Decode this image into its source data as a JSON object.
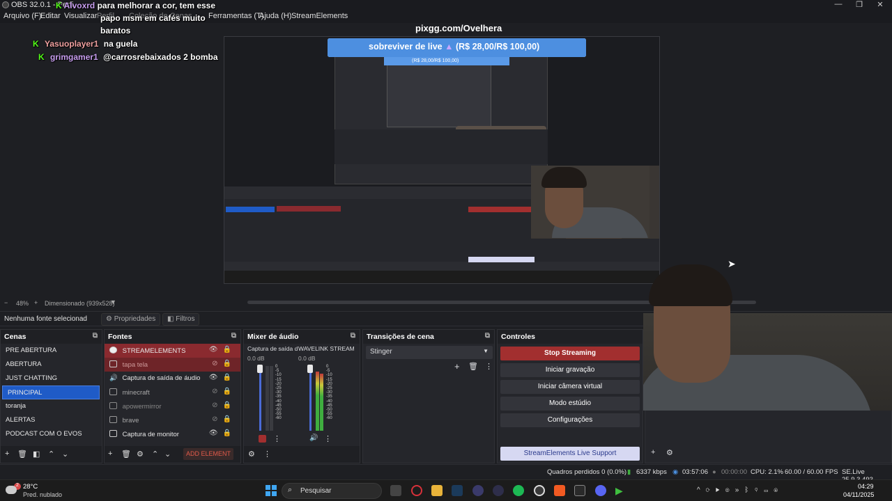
{
  "window": {
    "title": "OBS 32.0.1 - Perfi",
    "minimize": "—",
    "maximize": "❐",
    "close": "✕"
  },
  "menu": {
    "items": [
      "Arquivo (F)",
      "Editar",
      "Visualizar",
      "Perfil",
      "Coleção de Cenas",
      "Ferramentas (T)",
      "Ajuda (H)",
      "StreamElements"
    ]
  },
  "chat": {
    "messages": [
      {
        "user": "Alvoxrd",
        "text": "para melhorar a cor, tem esse"
      },
      {
        "user": "",
        "text": "papo msm em cafés muito"
      },
      {
        "user": "",
        "text": "baratos"
      },
      {
        "user": "Yasuoplayer1",
        "text": "na guela"
      },
      {
        "user": "grimgamer1",
        "text": "@carrosrebaixados 2 bomba"
      }
    ]
  },
  "overlay": {
    "url": "pixgg.com/Ovelhera",
    "goal_text": "sobreviver de live",
    "goal_amount": "(R$ 28,00/R$ 100,00)",
    "inner_goal": "(R$ 28,00/R$ 100,00)"
  },
  "preview_toolbar": {
    "zoom_minus": "−",
    "zoom": "48%",
    "zoom_plus": "+",
    "scale_label": "Dimensionado (939x528)"
  },
  "props_bar": {
    "no_source": "Nenhuma fonte selecionad",
    "properties": "Propriedades",
    "filters": "Filtros"
  },
  "scenes": {
    "title": "Cenas",
    "items": [
      "PRE ABERTURA",
      "ABERTURA",
      "JUST CHATTING",
      "PRINCIPAL",
      "toranja",
      "ALERTAS",
      "PODCAST COM O EVOS"
    ],
    "selected_index": 3
  },
  "sources": {
    "title": "Fontes",
    "items": [
      {
        "label": "STREAMELEMENTS",
        "state": "red"
      },
      {
        "label": "tapa tela",
        "state": "red-hidden"
      },
      {
        "label": "Captura de saída de áudio",
        "state": "normal"
      },
      {
        "label": "minecraft",
        "state": "hidden"
      },
      {
        "label": "apowermirror",
        "state": "hidden"
      },
      {
        "label": "brave",
        "state": "hidden"
      },
      {
        "label": "Captura de monitor",
        "state": "normal"
      }
    ],
    "add_element": "ADD ELEMENT"
  },
  "mixer": {
    "title": "Mixer de áudio",
    "channels": [
      {
        "name": "Captura de saída d",
        "db": "0.0 dB"
      },
      {
        "name": "WAVELINK STREAM",
        "db": "0.0 dB"
      }
    ],
    "scale": [
      "0",
      "-5",
      "-10",
      "-15",
      "-20",
      "-25",
      "-30",
      "-35",
      "-40",
      "-45",
      "-50",
      "-55",
      "-60"
    ]
  },
  "transitions": {
    "title": "Transições de cena",
    "selected": "Stinger"
  },
  "controls": {
    "title": "Controles",
    "buttons": [
      "Stop Streaming",
      "Iniciar gravação",
      "Iniciar câmera virtual",
      "Modo estúdio",
      "Configurações"
    ],
    "support": "StreamElements Live Support"
  },
  "status": {
    "dropped": "Quadros perdidos 0 (0.0%)",
    "bitrate": "6337 kbps",
    "live_time": "03:57:06",
    "rec_time": "00:00:00",
    "cpu": "CPU: 2.1%",
    "fps": "60.00 / 60.00 FPS",
    "se_version": "SE.Live 25.9.3.493"
  },
  "taskbar": {
    "weather_temp": "28°C",
    "weather_desc": "Pred. nublado",
    "weather_badge": "2",
    "search": "Pesquisar",
    "time": "04:29",
    "date": "04/11/2025"
  },
  "colors": {
    "accent_blue": "#1f5bc7",
    "stop_red": "#a22f2f",
    "source_red": "#8a2a2f",
    "kick_green": "#53fc18"
  }
}
